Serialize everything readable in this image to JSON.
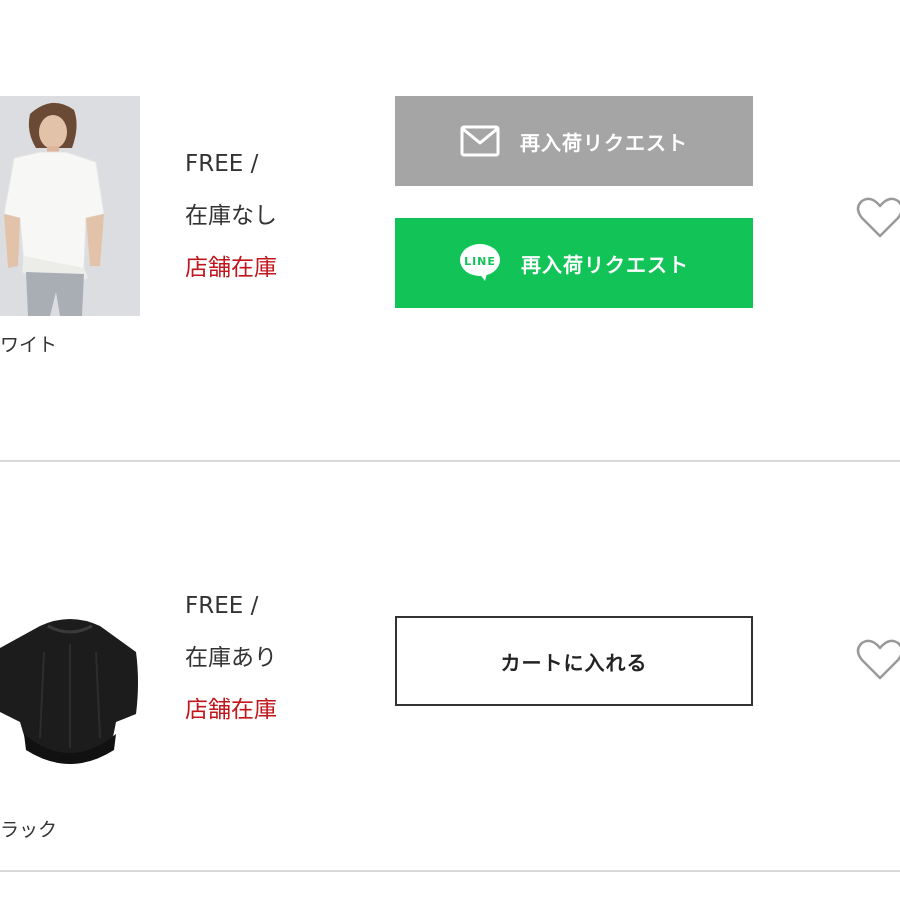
{
  "items": [
    {
      "color_label": "ワイト",
      "size": "FREE /",
      "stock": "在庫なし",
      "store_stock": "店舗在庫",
      "buttons": {
        "mail_request": "再入荷リクエスト",
        "line_request": "再入荷リクエスト",
        "line_badge": "LINE"
      },
      "favorite_icon": "heart-outline-icon"
    },
    {
      "color_label": "ラック",
      "size": "FREE /",
      "stock": "在庫あり",
      "store_stock": "店舗在庫",
      "buttons": {
        "cart": "カートに入れる"
      },
      "favorite_icon": "heart-outline-icon"
    }
  ],
  "colors": {
    "mail_button": "#a5a5a5",
    "line_button": "#12c357",
    "store_stock_text": "#c0161c",
    "divider": "#d9d9d9"
  }
}
